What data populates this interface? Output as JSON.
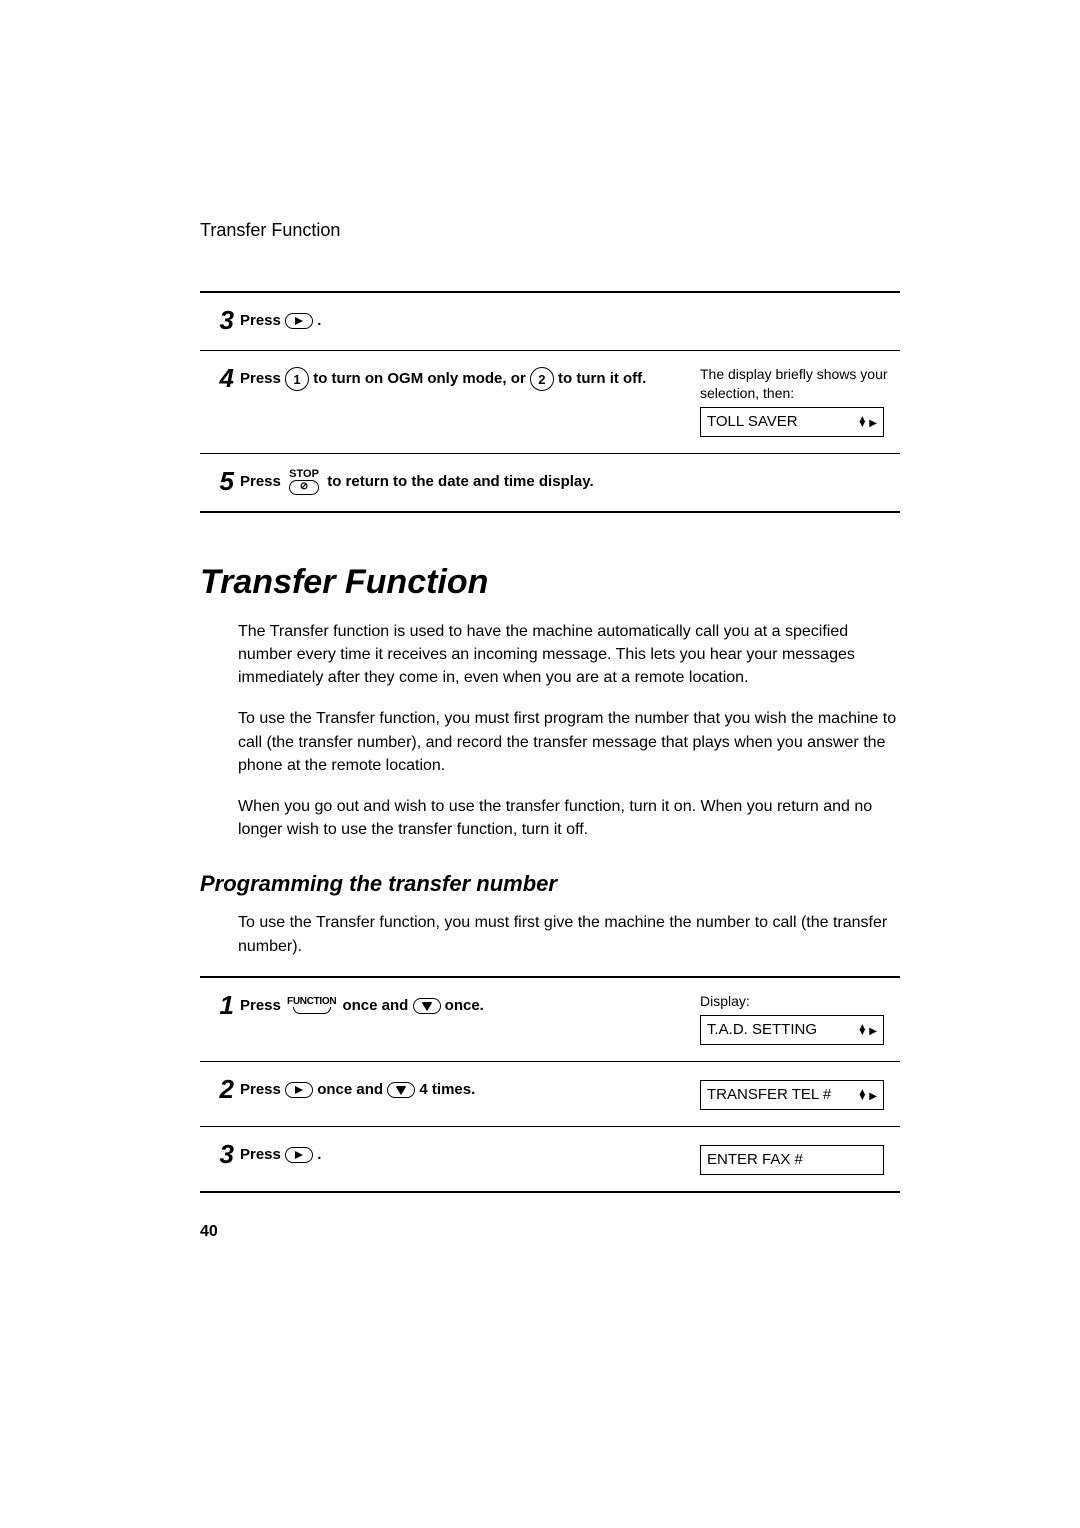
{
  "header": {
    "running_head": "Transfer Function"
  },
  "upper_steps": [
    {
      "num": "3",
      "parts": [
        {
          "t": "text",
          "v": "Press "
        },
        {
          "t": "play"
        },
        {
          "t": "text",
          "v": " ."
        }
      ],
      "side": null
    },
    {
      "num": "4",
      "parts": [
        {
          "t": "text",
          "v": "Press "
        },
        {
          "t": "circle",
          "v": "1"
        },
        {
          "t": "text",
          "v": " to turn on OGM only mode, or "
        },
        {
          "t": "circle",
          "v": "2"
        },
        {
          "t": "text",
          "v": " to turn it off."
        }
      ],
      "side": {
        "note": "The display briefly shows your selection, then:",
        "lcd": "TOLL SAVER",
        "updown": true,
        "right": true
      }
    },
    {
      "num": "5",
      "parts": [
        {
          "t": "text",
          "v": "Press "
        },
        {
          "t": "stop",
          "v": "STOP"
        },
        {
          "t": "text",
          "v": " to return to the date and time display."
        }
      ],
      "side": null,
      "last": true
    }
  ],
  "section": {
    "title": "Transfer Function",
    "paras": [
      "The Transfer function is used to have the machine automatically call you at a specified number every time it receives an incoming message. This lets you hear your messages immediately after they come in, even when you are at a remote location.",
      "To use the Transfer function, you must first program the number that you wish the machine to call (the transfer number), and record the transfer message that plays when you answer the phone at the remote location.",
      "When you go out and wish to use the transfer function, turn it on. When you return and no longer wish to use the transfer function, turn it off."
    ],
    "sub_title": "Programming the transfer number",
    "sub_para": "To use the Transfer function, you must first give the machine the number to call (the transfer number)."
  },
  "lower_steps": [
    {
      "num": "1",
      "parts": [
        {
          "t": "text",
          "v": "Press "
        },
        {
          "t": "function",
          "v": "FUNCTION"
        },
        {
          "t": "text",
          "v": " once and "
        },
        {
          "t": "down"
        },
        {
          "t": "text",
          "v": " once."
        }
      ],
      "side": {
        "note": "Display:",
        "lcd": "T.A.D. SETTING",
        "updown": true,
        "right": true
      }
    },
    {
      "num": "2",
      "parts": [
        {
          "t": "text",
          "v": "Press "
        },
        {
          "t": "play"
        },
        {
          "t": "text",
          "v": " once and "
        },
        {
          "t": "down"
        },
        {
          "t": "text",
          "v": " 4 times."
        }
      ],
      "side": {
        "lcd": "TRANSFER TEL #",
        "updown": true,
        "right": true
      }
    },
    {
      "num": "3",
      "parts": [
        {
          "t": "text",
          "v": "Press "
        },
        {
          "t": "play"
        },
        {
          "t": "text",
          "v": " ."
        }
      ],
      "side": {
        "lcd": "ENTER FAX #",
        "updown": false,
        "right": false
      },
      "last": true
    }
  ],
  "page_number": "40"
}
